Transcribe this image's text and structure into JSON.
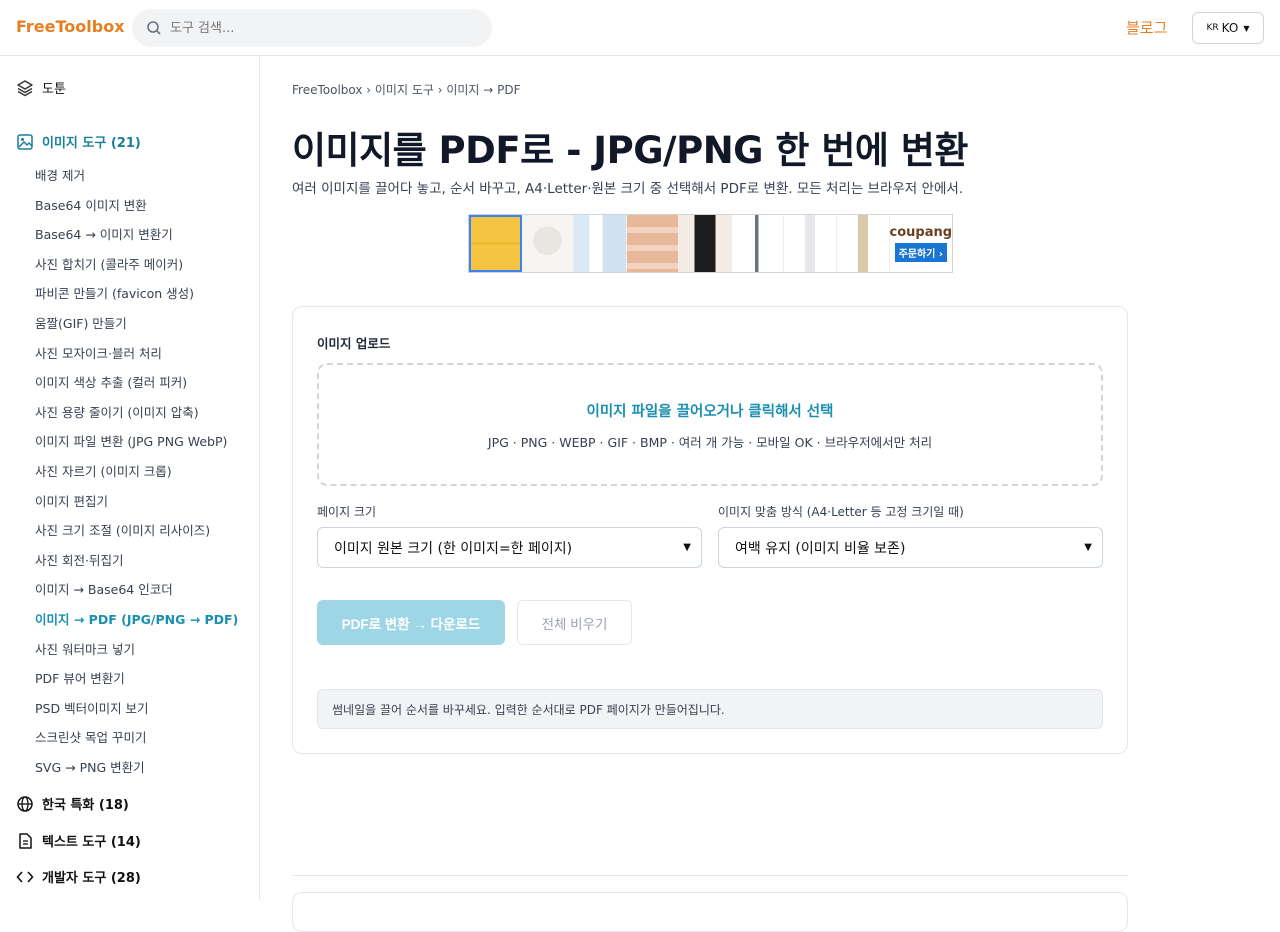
{
  "header": {
    "logo": "FreeToolbox",
    "search_placeholder": "도구 검색...",
    "blog": "블로그",
    "lang_flag": "KR",
    "lang": "KO"
  },
  "sidebar": {
    "top_item": "도툰",
    "active_category": "이미지 도구 (21)",
    "items": [
      "배경 제거",
      "Base64 이미지 변환",
      "Base64 → 이미지 변환기",
      "사진 합치기 (콜라주 메이커)",
      "파비콘 만들기 (favicon 생성)",
      "움짤(GIF) 만들기",
      "사진 모자이크·블러 처리",
      "이미지 색상 추출 (컬러 피커)",
      "사진 용량 줄이기 (이미지 압축)",
      "이미지 파일 변환 (JPG PNG WebP)",
      "사진 자르기 (이미지 크롭)",
      "이미지 편집기",
      "사진 크기 조절 (이미지 리사이즈)",
      "사진 회전·뒤집기",
      "이미지 → Base64 인코더",
      "이미지 → PDF (JPG/PNG → PDF)",
      "사진 워터마크 넣기",
      "PDF 뷰어 변환기",
      "PSD 벡터이미지 보기",
      "스크린샷 목업 꾸미기",
      "SVG → PNG 변환기"
    ],
    "other_categories": [
      "한국 특화 (18)",
      "텍스트 도구 (14)",
      "개발자 도구 (28)"
    ]
  },
  "main": {
    "breadcrumb": "FreeToolbox › 이미지 도구 › 이미지 → PDF",
    "title": "이미지를 PDF로 - JPG/PNG 한 번에 변환",
    "description": "여러 이미지를 끌어다 놓고, 순서 바꾸고, A4·Letter·원본 크기 중 선택해서 PDF로 변환. 모든 처리는 브라우저 안에서.",
    "ad": {
      "brand": "coupang",
      "order": "주문하기 ›"
    },
    "upload_label": "이미지 업로드",
    "dropzone_title": "이미지 파일을 끌어오거나 클릭해서 선택",
    "dropzone_sub": "JPG · PNG · WEBP · GIF · BMP · 여러 개 가능 · 모바일 OK · 브라우저에서만 처리",
    "page_size_label": "페이지 크기",
    "page_size_value": "이미지 원본 크기 (한 이미지=한 페이지)",
    "fit_label": "이미지 맞춤 방식 (A4·Letter 등 고정 크기일 때)",
    "fit_value": "여백 유지 (이미지 비율 보존)",
    "convert_button": "PDF로 변환 → 다운로드",
    "clear_button": "전체 비우기",
    "note": "썸네일을 끌어 순서를 바꾸세요. 입력한 순서대로 PDF 페이지가 만들어집니다."
  },
  "colors": {
    "accent": "#1a8fb0",
    "brand": "#e67e22"
  }
}
